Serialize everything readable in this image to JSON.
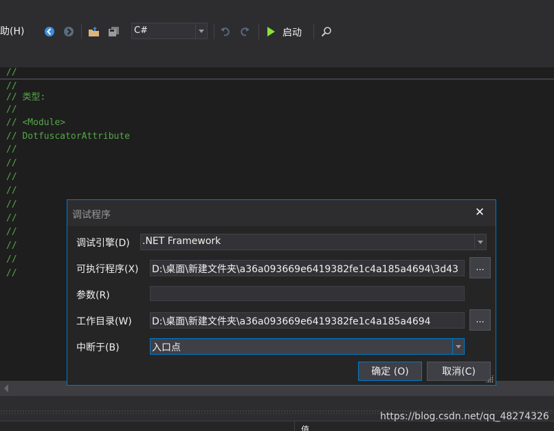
{
  "toolbar": {
    "help_menu": "助(H)",
    "language_value": "C#",
    "start_label": "启动"
  },
  "editor": {
    "first_line": "//",
    "lines": [
      "//",
      "// 类型:",
      "//",
      "// <Module>",
      "// DotfuscatorAttribute",
      "//",
      "//",
      "//",
      "//",
      "//",
      "//",
      "//",
      "//",
      "//",
      "//"
    ]
  },
  "dialog": {
    "title": "调试程序",
    "engine_label": "调试引擎(D)",
    "engine_value": ".NET Framework",
    "exe_label": "可执行程序(X)",
    "exe_value": "D:\\桌面\\新建文件夹\\a36a093669e6419382fe1c4a185a4694\\3d43",
    "args_label": "参数(R)",
    "args_value": "",
    "workdir_label": "工作目录(W)",
    "workdir_value": "D:\\桌面\\新建文件夹\\a36a093669e6419382fe1c4a185a4694",
    "break_label": "中断于(B)",
    "break_value": "入口点",
    "browse_label": "...",
    "ok_label": "确定 (O)",
    "cancel_label": "取消(C)"
  },
  "bottom_panel": {
    "column_header": "值"
  },
  "watermark": "https://blog.csdn.net/qq_48274326",
  "colors": {
    "accent": "#007acc",
    "comment": "#57a64a",
    "start_green": "#8ae234",
    "nav_blue": "#3e8ede"
  }
}
